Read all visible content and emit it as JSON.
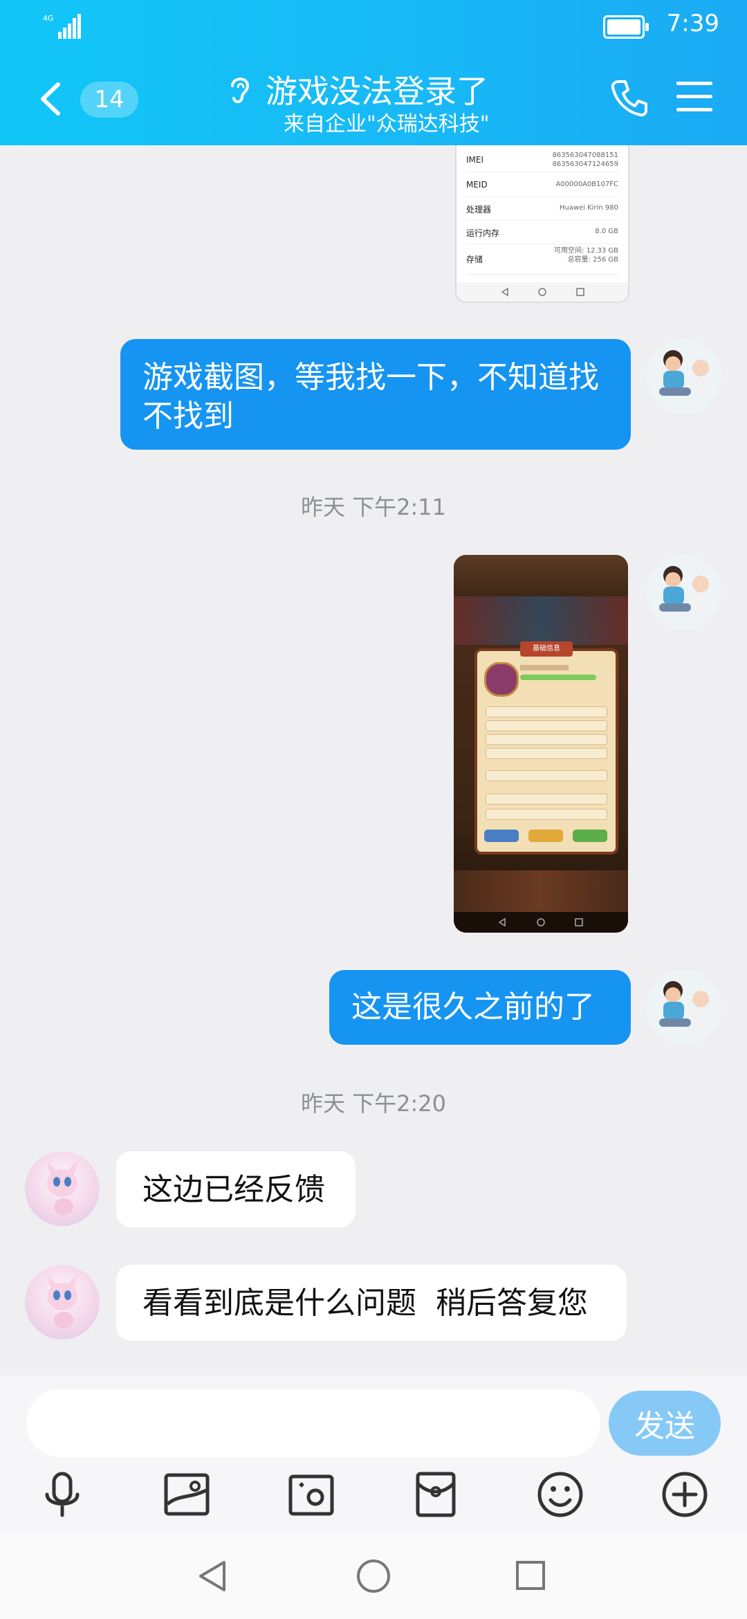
{
  "status_bar": {
    "network": "4G",
    "time": "7:39"
  },
  "header": {
    "unread_count": "14",
    "title": "游戏没法登录了",
    "subtitle": "来自企业\"众瑞达科技\""
  },
  "device_info": {
    "rows": [
      {
        "key": "IMEI",
        "value": "863563047088151\n863563047124659"
      },
      {
        "key": "MEID",
        "value": "A00000A0B107FC"
      },
      {
        "key": "处理器",
        "value": "Huawei Kirin 980"
      },
      {
        "key": "运行内存",
        "value": "8.0 GB"
      },
      {
        "key": "存储",
        "value": "可用空间: 12.33 GB\n总容量: 256 GB"
      }
    ]
  },
  "messages": {
    "m1": "游戏截图，等我找一下，不知道找不找到",
    "ts1": "昨天 下午2:11",
    "m2": "这是很久之前的了",
    "ts2": "昨天 下午2:20",
    "m3": "这边已经反馈",
    "m4": "看看到底是什么问题  稍后答复您"
  },
  "game_screenshot": {
    "panel_title": "基础信息"
  },
  "input": {
    "placeholder": "",
    "send_label": "发送"
  },
  "toolbar_icons": [
    "microphone-icon",
    "image-icon",
    "camera-icon",
    "red-packet-icon",
    "emoji-icon",
    "plus-icon"
  ],
  "colors": {
    "header": "#18b9f6",
    "outgoing_bubble": "#1694f2",
    "send_button": "#86c9f7"
  }
}
